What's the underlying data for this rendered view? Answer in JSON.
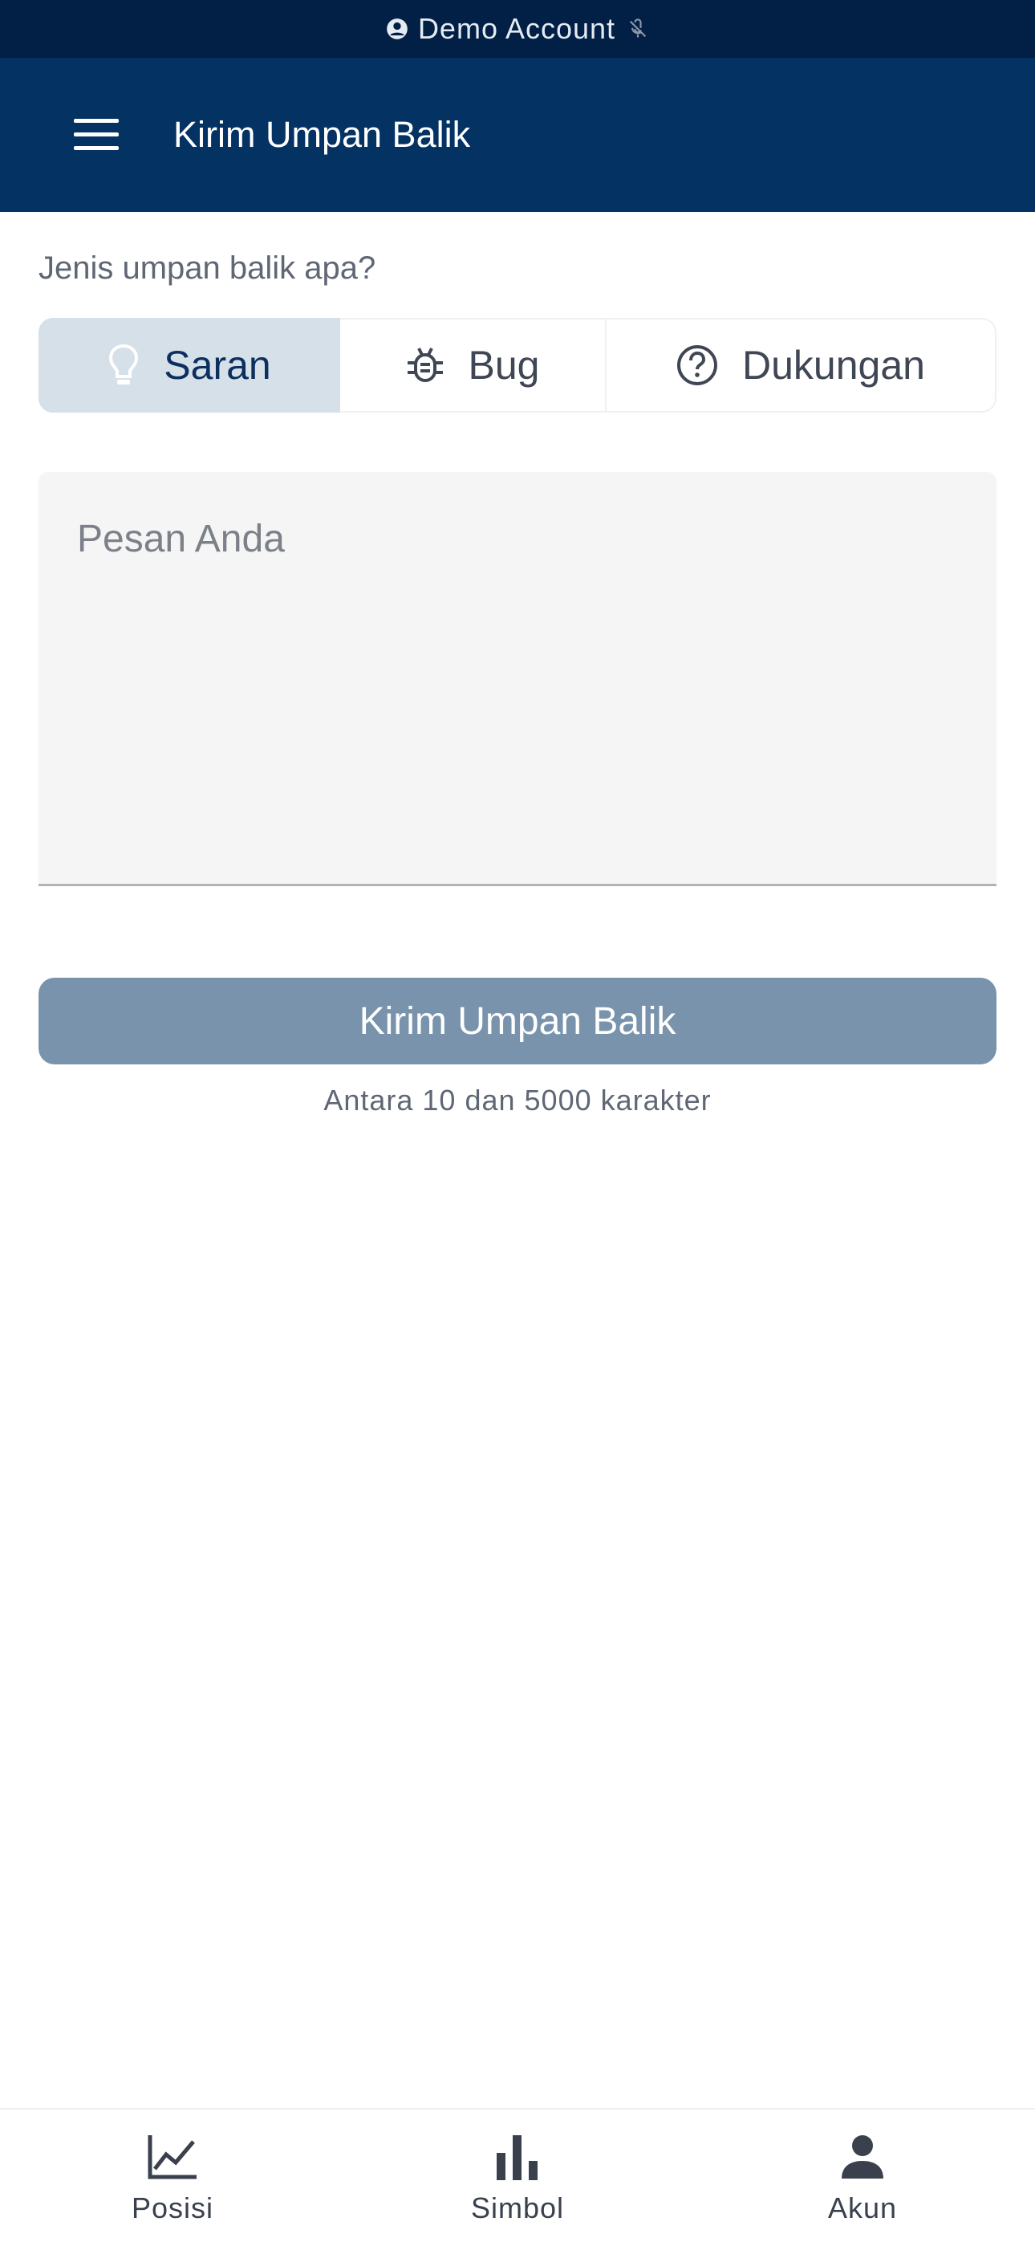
{
  "status_bar": {
    "label": "Demo Account"
  },
  "app_bar": {
    "title": "Kirim Umpan Balik"
  },
  "form": {
    "question": "Jenis umpan balik apa?",
    "types": [
      {
        "label": "Saran",
        "icon": "lightbulb-icon",
        "selected": true
      },
      {
        "label": "Bug",
        "icon": "bug-icon",
        "selected": false
      },
      {
        "label": "Dukungan",
        "icon": "help-circle-icon",
        "selected": false
      }
    ],
    "message_placeholder": "Pesan Anda",
    "message_value": "",
    "submit_label": "Kirim Umpan Balik",
    "hint": "Antara 10 dan 5000 karakter"
  },
  "bottom_nav": {
    "items": [
      {
        "label": "Posisi",
        "icon": "line-chart-icon"
      },
      {
        "label": "Simbol",
        "icon": "bar-chart-icon"
      },
      {
        "label": "Akun",
        "icon": "person-icon"
      }
    ]
  },
  "colors": {
    "status_bar_bg": "#022046",
    "app_bar_bg": "#033263",
    "selected_segment_bg": "#d6e0e9",
    "submit_disabled_bg": "#7893ab"
  }
}
